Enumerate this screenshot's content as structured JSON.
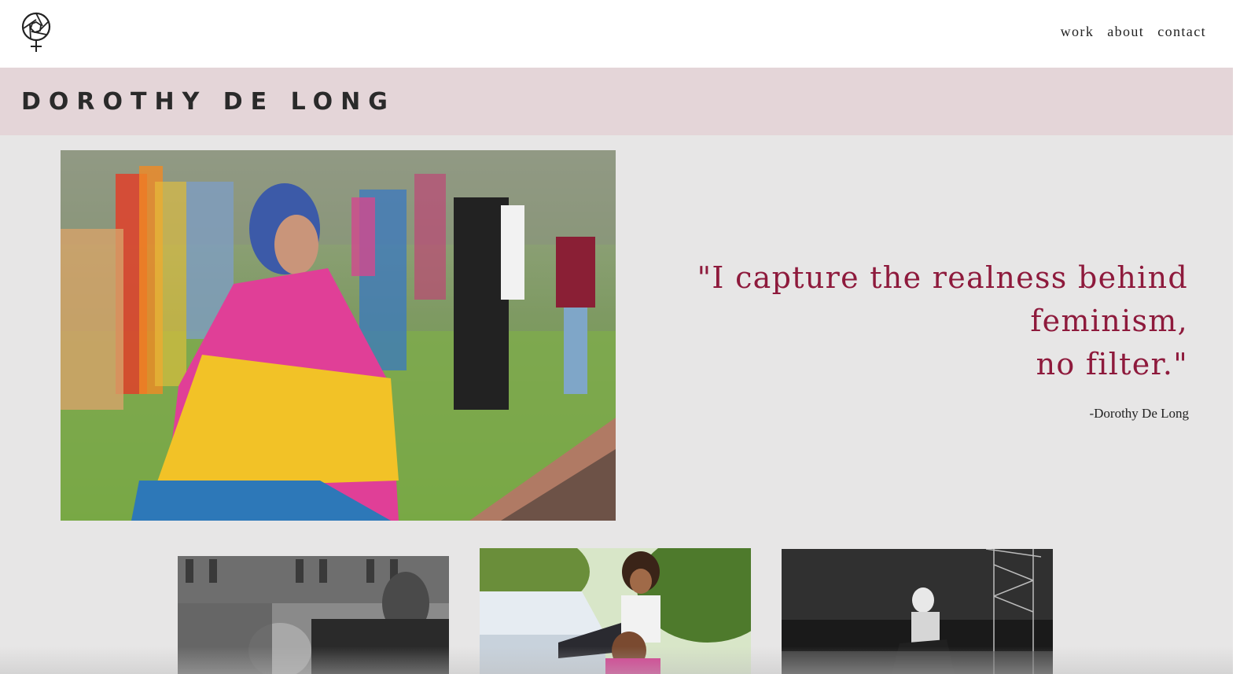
{
  "site": {
    "logo_icon": "aperture-venus-icon"
  },
  "nav": {
    "items": [
      {
        "label": "work"
      },
      {
        "label": "about"
      },
      {
        "label": "contact"
      }
    ]
  },
  "banner": {
    "title": "DOROTHY DE LONG"
  },
  "hero": {
    "image_subject": "person wrapped in pink yellow blue flag at pride event"
  },
  "quote": {
    "lines": [
      "\"I capture the realness behind",
      "feminism,",
      "no filter.\""
    ],
    "attribution": "-Dorothy De Long",
    "color": "#8e1a3c"
  },
  "colors": {
    "banner_bg": "#e4d5d8",
    "page_bg": "#e7e6e6",
    "accent": "#8e1a3c"
  }
}
